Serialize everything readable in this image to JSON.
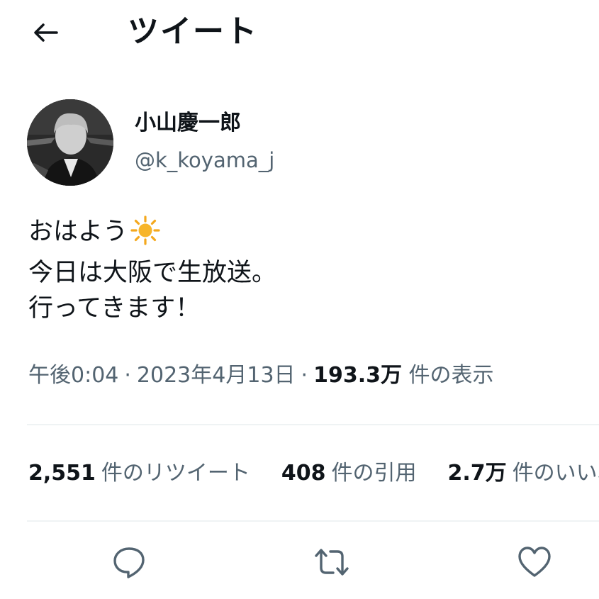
{
  "header": {
    "back_icon": "arrow-left-icon",
    "title": "ツイート"
  },
  "author": {
    "display_name": "小山慶一郎",
    "handle": "@k_koyama_j"
  },
  "tweet": {
    "lines": [
      "おはよう",
      "今日は大阪で生放送。",
      "行ってきます！"
    ],
    "emoji": "sun-emoji"
  },
  "meta": {
    "time": "午後0:04",
    "separator": "·",
    "date": "2023年4月13日",
    "views_count": "193.3万",
    "views_label": "件の表示"
  },
  "stats": {
    "retweets_count": "2,551",
    "retweets_label": "件のリツイート",
    "quotes_count": "408",
    "quotes_label": "件の引用",
    "likes_count": "2.7万",
    "likes_label": "件のいいね"
  },
  "actions": {
    "reply_icon": "reply-icon",
    "retweet_icon": "retweet-icon",
    "like_icon": "heart-icon"
  },
  "colors": {
    "text_primary": "#0f1419",
    "text_secondary": "#536471",
    "divider": "#eff3f4",
    "sun": "#f4a81d"
  }
}
